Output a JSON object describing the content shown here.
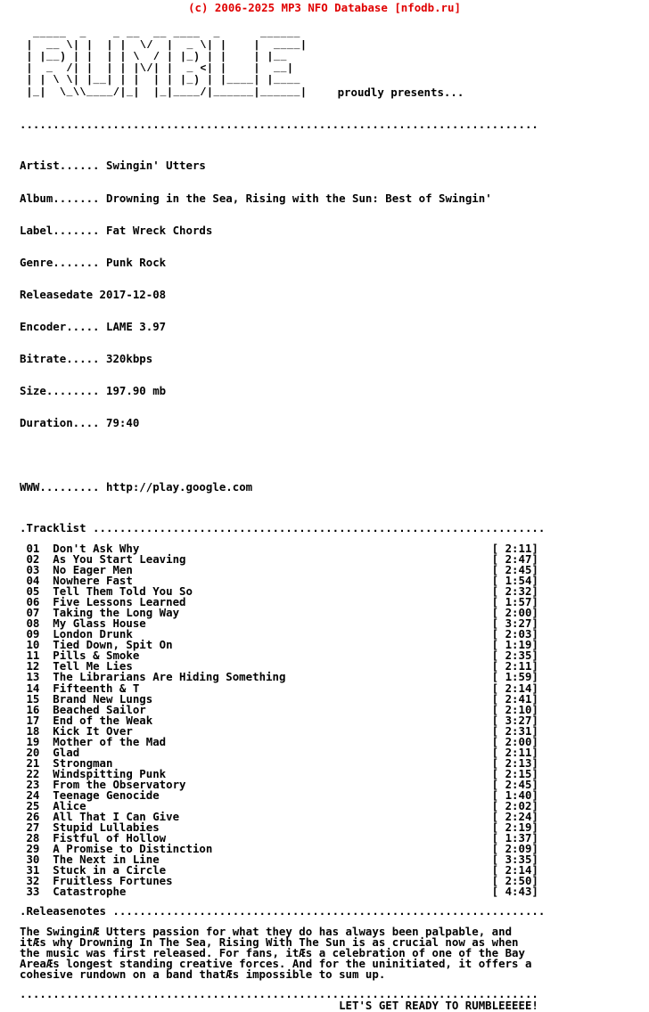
{
  "header": {
    "credit": "(c) 2006-2025 MP3 NFO Database [nfodb.ru]",
    "credit_color": "#e00000"
  },
  "logo": {
    "ascii_name": "rumble-ascii-logo",
    "text": "  _____  _    _ __  __ ____  _      ______\n |  __ \\| |  | |  \\/  |  _ \\| |    |  ____|\n | |__) | |  | | \\  / | |_) | |    | |__\n |  _  /| |  | | |\\/| |  _ <| |    |  __|\n | | \\ \\| |__| | |  | | |_) | |____| |____\n |_|  \\_\\\\____/|_|  |_|____/|______|______|",
    "tagline": "proudly presents..."
  },
  "separators": {
    "top_rule": "..............................................................................",
    "tracklist_header": ".Tracklist ....................................................................",
    "releasenotes_header": ".Releasenotes .................................................................",
    "bottom_rule": ".............................................................................."
  },
  "metadata": {
    "labels": {
      "artist": "Artist......",
      "album": "Album.......",
      "label": "Label.......",
      "genre": "Genre.......",
      "releasedate": "Releasedate",
      "encoder": "Encoder.....",
      "bitrate": "Bitrate.....",
      "size": "Size........",
      "duration": "Duration....",
      "www": "WWW........."
    },
    "values": {
      "artist": "Swingin' Utters",
      "album": "Drowning in the Sea, Rising with the Sun: Best of Swingin'",
      "label": "Fat Wreck Chords",
      "genre": "Punk Rock",
      "releasedate": "2017-12-08",
      "encoder": "LAME 3.97",
      "bitrate": "320kbps",
      "size": "197.90 mb",
      "duration": "79:40",
      "www": "http://play.google.com"
    }
  },
  "tracklist": {
    "tracks": [
      {
        "num": "01",
        "title": "Don't Ask Why",
        "duration": "[ 2:11]"
      },
      {
        "num": "02",
        "title": "As You Start Leaving",
        "duration": "[ 2:47]"
      },
      {
        "num": "03",
        "title": "No Eager Men",
        "duration": "[ 2:45]"
      },
      {
        "num": "04",
        "title": "Nowhere Fast",
        "duration": "[ 1:54]"
      },
      {
        "num": "05",
        "title": "Tell Them Told You So",
        "duration": "[ 2:32]"
      },
      {
        "num": "06",
        "title": "Five Lessons Learned",
        "duration": "[ 1:57]"
      },
      {
        "num": "07",
        "title": "Taking the Long Way",
        "duration": "[ 2:00]"
      },
      {
        "num": "08",
        "title": "My Glass House",
        "duration": "[ 3:27]"
      },
      {
        "num": "09",
        "title": "London Drunk",
        "duration": "[ 2:03]"
      },
      {
        "num": "10",
        "title": "Tied Down, Spit On",
        "duration": "[ 1:19]"
      },
      {
        "num": "11",
        "title": "Pills & Smoke",
        "duration": "[ 2:35]"
      },
      {
        "num": "12",
        "title": "Tell Me Lies",
        "duration": "[ 2:11]"
      },
      {
        "num": "13",
        "title": "The Librarians Are Hiding Something",
        "duration": "[ 1:59]"
      },
      {
        "num": "14",
        "title": "Fifteenth & T",
        "duration": "[ 2:14]"
      },
      {
        "num": "15",
        "title": "Brand New Lungs",
        "duration": "[ 2:41]"
      },
      {
        "num": "16",
        "title": "Beached Sailor",
        "duration": "[ 2:10]"
      },
      {
        "num": "17",
        "title": "End of the Weak",
        "duration": "[ 3:27]"
      },
      {
        "num": "18",
        "title": "Kick It Over",
        "duration": "[ 2:31]"
      },
      {
        "num": "19",
        "title": "Mother of the Mad",
        "duration": "[ 2:00]"
      },
      {
        "num": "20",
        "title": "Glad",
        "duration": "[ 2:11]"
      },
      {
        "num": "21",
        "title": "Strongman",
        "duration": "[ 2:13]"
      },
      {
        "num": "22",
        "title": "Windspitting Punk",
        "duration": "[ 2:15]"
      },
      {
        "num": "23",
        "title": "From the Observatory",
        "duration": "[ 2:45]"
      },
      {
        "num": "24",
        "title": "Teenage Genocide",
        "duration": "[ 1:40]"
      },
      {
        "num": "25",
        "title": "Alice",
        "duration": "[ 2:02]"
      },
      {
        "num": "26",
        "title": "All That I Can Give",
        "duration": "[ 2:24]"
      },
      {
        "num": "27",
        "title": "Stupid Lullabies",
        "duration": "[ 2:19]"
      },
      {
        "num": "28",
        "title": "Fistful of Hollow",
        "duration": "[ 1:37]"
      },
      {
        "num": "29",
        "title": "A Promise to Distinction",
        "duration": "[ 2:09]"
      },
      {
        "num": "30",
        "title": "The Next in Line",
        "duration": "[ 3:35]"
      },
      {
        "num": "31",
        "title": "Stuck in a Circle",
        "duration": "[ 2:14]"
      },
      {
        "num": "32",
        "title": "Fruitless Fortunes",
        "duration": "[ 2:50]"
      },
      {
        "num": "33",
        "title": "Catastrophe",
        "duration": "[ 4:43]"
      }
    ]
  },
  "releasenotes": {
    "lines": [
      "The SwinginÆ Utters passion for what they do has always been palpable, and",
      "itÆs why Drowning In The Sea, Rising With The Sun is as crucial now as when",
      "the music was first released. For fans, itÆs a celebration of one of the Bay",
      "AreaÆs longest standing creative forces. And for the uninitiated, it offers a",
      "cohesive rundown on a band thatÆs impossible to sum up."
    ]
  },
  "footer": {
    "tagline": "LET'S GET READY TO RUMBLEEEEE!"
  }
}
